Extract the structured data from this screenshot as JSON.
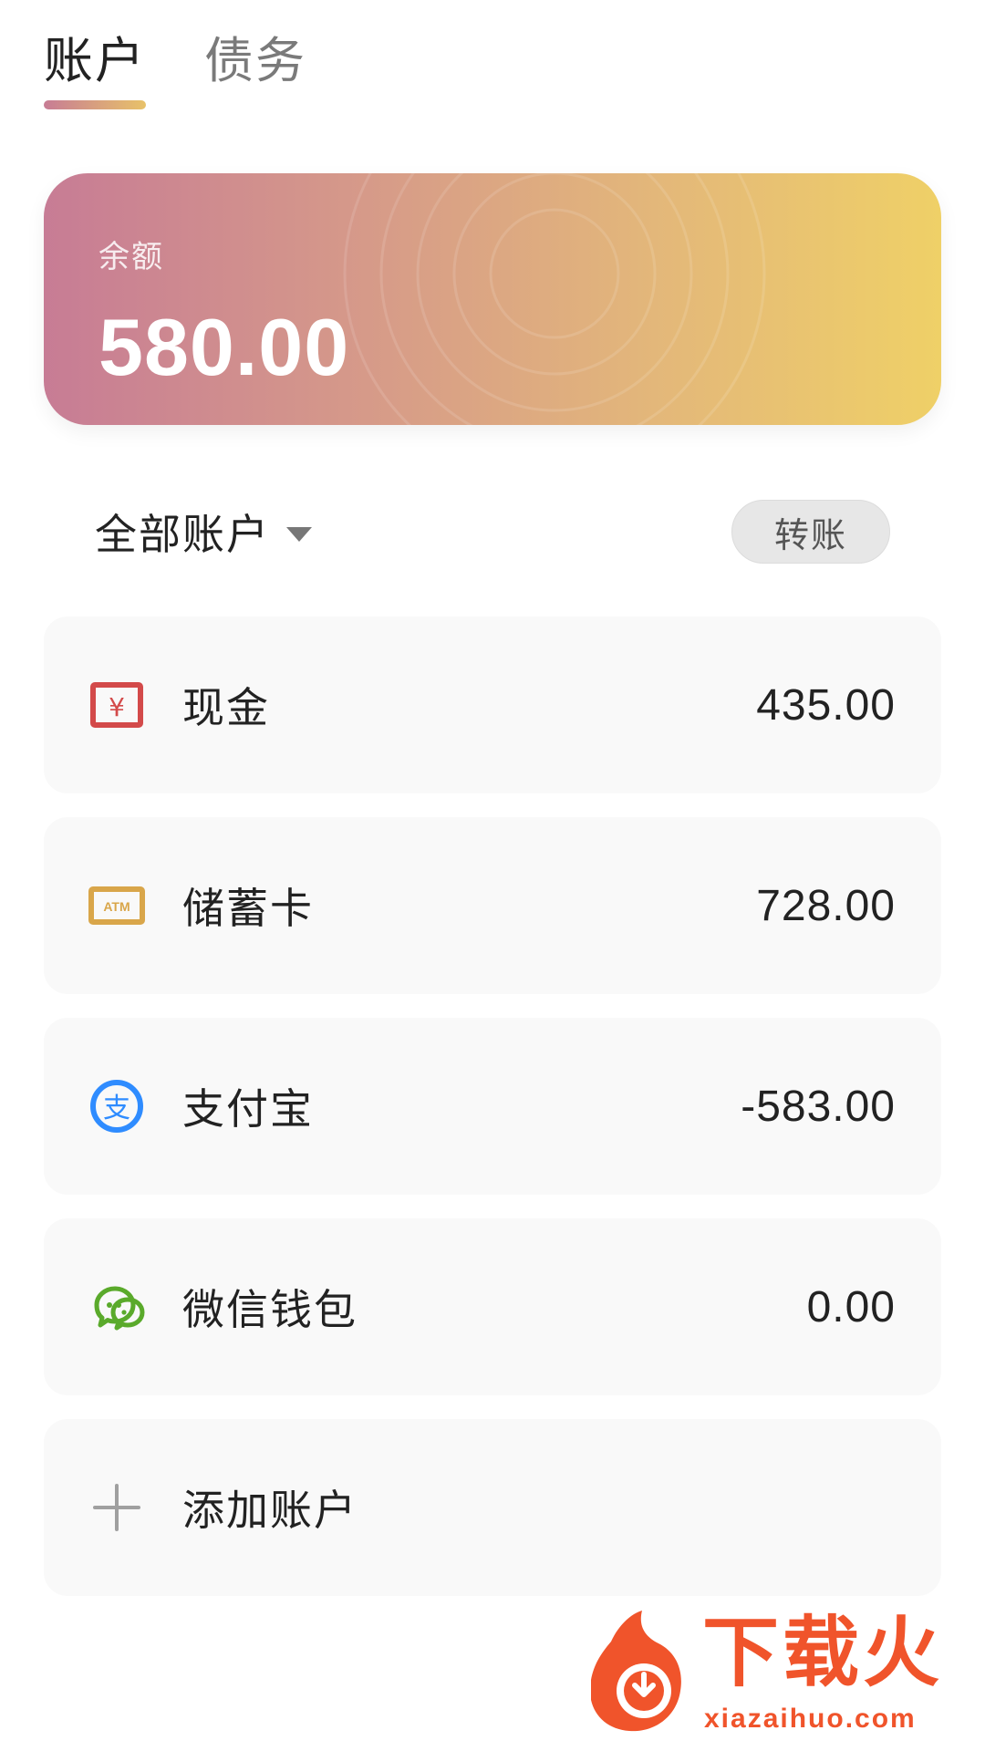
{
  "tabs": {
    "account": "账户",
    "debt": "债务"
  },
  "balance": {
    "label": "余额",
    "value": "580.00"
  },
  "filter": {
    "title": "全部账户",
    "transfer_label": "转账"
  },
  "accounts": [
    {
      "name": "现金",
      "amount": "435.00",
      "icon": "cash-icon"
    },
    {
      "name": "储蓄卡",
      "amount": "728.00",
      "icon": "atm-card-icon"
    },
    {
      "name": "支付宝",
      "amount": "-583.00",
      "icon": "alipay-icon"
    },
    {
      "name": "微信钱包",
      "amount": "0.00",
      "icon": "wechat-icon"
    }
  ],
  "add_account": {
    "label": "添加账户",
    "icon": "plus-icon"
  },
  "watermark": {
    "title": "下载火",
    "url": "xiazaihuo.com"
  },
  "icons": {
    "cash_text": "¥",
    "atm_text": "ATM",
    "alipay_text": "支"
  },
  "colors": {
    "card_gradient_start": "#c77c95",
    "card_gradient_end": "#efd067",
    "cash_icon": "#d34a4a",
    "atm_icon": "#d9a64a",
    "alipay_icon": "#2f8cff",
    "wechat_icon": "#5aaa2b",
    "watermark": "#f0542b"
  }
}
